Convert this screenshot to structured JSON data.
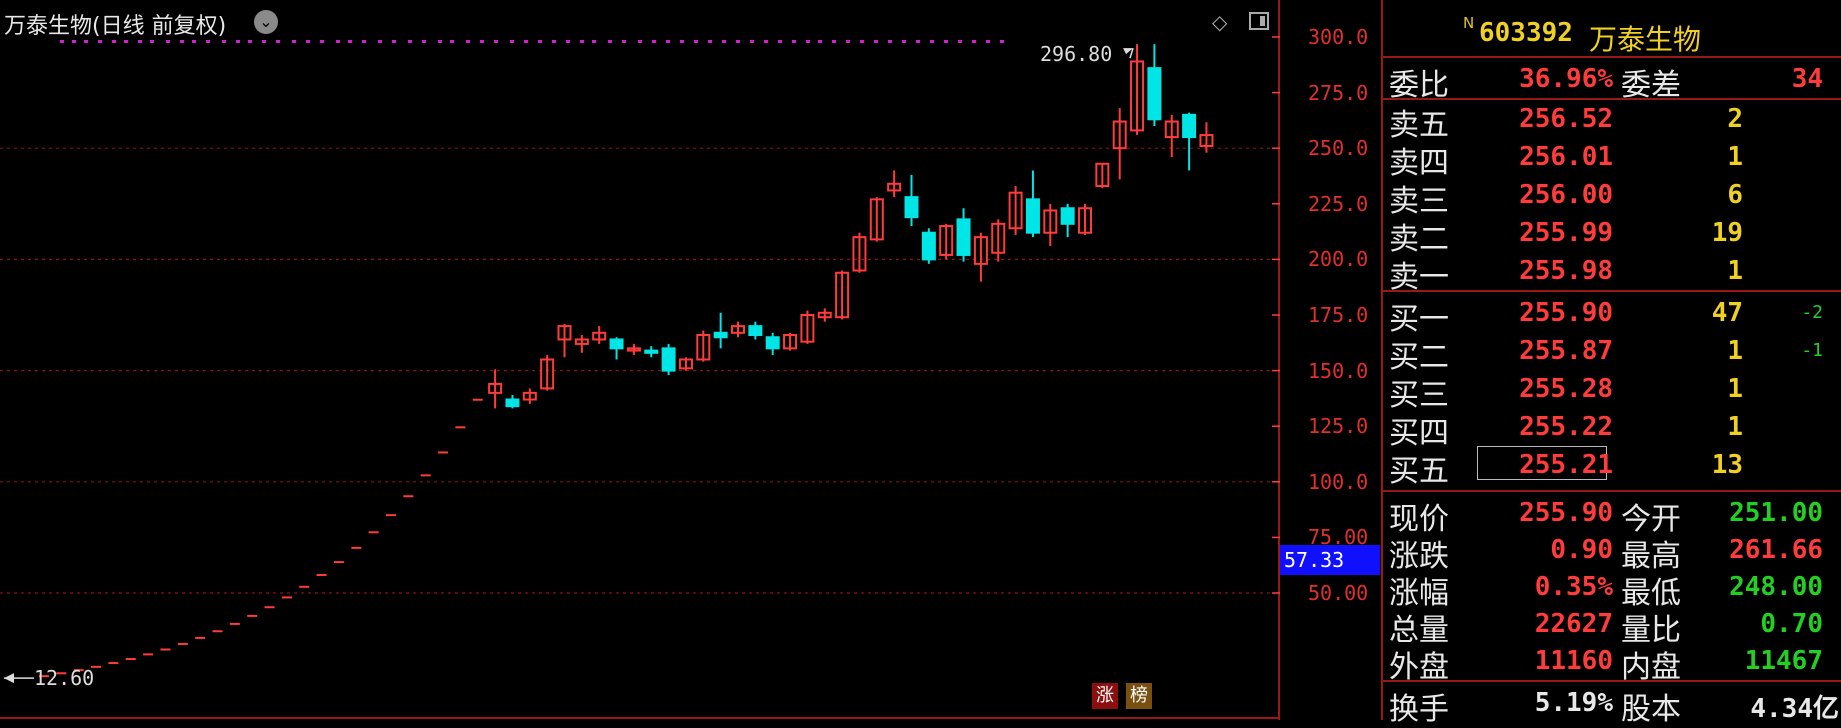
{
  "chart_title": "万泰生物(日线 前复权)",
  "title_dropdown_icon": "chevron-down-icon",
  "toolbar_icons": [
    "diamond-icon",
    "panel-toggle-icon"
  ],
  "y_ticks": [
    "300.0",
    "275.0",
    "250.0",
    "225.0",
    "200.0",
    "175.0",
    "150.0",
    "125.0",
    "100.0",
    "75.00",
    "50.00"
  ],
  "current_price_tag": "57.33",
  "high_annotation": "296.80",
  "low_annotation": "12.60",
  "badges": {
    "zhang": "涨",
    "bang": "榜"
  },
  "colors": {
    "up": "#ff3b3b",
    "down": "#00e5e5",
    "grid": "#8b1010",
    "marker": "#d020d0",
    "panel_border": "#9a1818"
  },
  "chart_data": {
    "type": "candlestick",
    "y_unit": "CNY",
    "ylim": [
      12.6,
      296.8
    ],
    "y_tick_values": [
      300,
      275,
      250,
      225,
      200,
      175,
      150,
      125,
      100,
      75,
      50
    ],
    "grid_levels": [
      250,
      200,
      150,
      100,
      50
    ],
    "high_marker": 296.8,
    "low_marker": 12.6,
    "limit_up_closes": [
      12.6,
      13.9,
      15.3,
      16.8,
      18.5,
      20.3,
      22.4,
      24.6,
      27.1,
      29.8,
      32.8,
      36.1,
      39.7,
      43.6,
      48.0,
      52.8,
      58.1,
      63.9,
      70.3,
      77.3,
      85.0,
      93.5,
      102.9,
      113.2,
      124.5,
      136.9
    ],
    "candles": [
      {
        "o": 140.0,
        "h": 150.6,
        "l": 133.0,
        "c": 144.0
      },
      {
        "o": 137.0,
        "h": 139.0,
        "l": 133.0,
        "c": 134.0
      },
      {
        "o": 137.0,
        "h": 142.0,
        "l": 135.0,
        "c": 140.0
      },
      {
        "o": 142.0,
        "h": 157.0,
        "l": 141.0,
        "c": 155.0
      },
      {
        "o": 164.0,
        "h": 171.0,
        "l": 156.0,
        "c": 170.0
      },
      {
        "o": 162.0,
        "h": 166.0,
        "l": 158.0,
        "c": 164.0
      },
      {
        "o": 164.0,
        "h": 170.0,
        "l": 162.0,
        "c": 167.0
      },
      {
        "o": 164.0,
        "h": 165.0,
        "l": 155.0,
        "c": 160.0
      },
      {
        "o": 159.0,
        "h": 162.0,
        "l": 157.0,
        "c": 160.0
      },
      {
        "o": 159.0,
        "h": 161.0,
        "l": 156.0,
        "c": 158.0
      },
      {
        "o": 160.0,
        "h": 162.0,
        "l": 148.0,
        "c": 150.0
      },
      {
        "o": 151.0,
        "h": 156.0,
        "l": 150.0,
        "c": 155.0
      },
      {
        "o": 155.0,
        "h": 168.0,
        "l": 154.0,
        "c": 166.0
      },
      {
        "o": 167.0,
        "h": 176.0,
        "l": 160.0,
        "c": 165.0
      },
      {
        "o": 167.0,
        "h": 172.0,
        "l": 165.0,
        "c": 170.0
      },
      {
        "o": 170.0,
        "h": 172.0,
        "l": 164.0,
        "c": 166.0
      },
      {
        "o": 165.0,
        "h": 167.0,
        "l": 157.0,
        "c": 160.0
      },
      {
        "o": 160.0,
        "h": 167.0,
        "l": 159.0,
        "c": 166.0
      },
      {
        "o": 163.0,
        "h": 177.0,
        "l": 162.0,
        "c": 175.0
      },
      {
        "o": 174.0,
        "h": 178.0,
        "l": 172.0,
        "c": 176.0
      },
      {
        "o": 174.0,
        "h": 195.0,
        "l": 173.0,
        "c": 194.0
      },
      {
        "o": 195.0,
        "h": 212.0,
        "l": 194.0,
        "c": 210.0
      },
      {
        "o": 209.0,
        "h": 228.0,
        "l": 208.0,
        "c": 227.0
      },
      {
        "o": 231.0,
        "h": 240.0,
        "l": 228.0,
        "c": 234.0
      },
      {
        "o": 228.0,
        "h": 238.0,
        "l": 215.0,
        "c": 219.0
      },
      {
        "o": 212.0,
        "h": 214.0,
        "l": 198.0,
        "c": 200.0
      },
      {
        "o": 202.0,
        "h": 216.0,
        "l": 200.0,
        "c": 215.0
      },
      {
        "o": 218.0,
        "h": 223.0,
        "l": 199.0,
        "c": 202.0
      },
      {
        "o": 198.0,
        "h": 212.0,
        "l": 190.0,
        "c": 210.0
      },
      {
        "o": 203.0,
        "h": 218.0,
        "l": 199.0,
        "c": 216.0
      },
      {
        "o": 214.0,
        "h": 233.0,
        "l": 211.0,
        "c": 230.0
      },
      {
        "o": 227.0,
        "h": 240.0,
        "l": 210.0,
        "c": 212.0
      },
      {
        "o": 212.0,
        "h": 225.0,
        "l": 206.0,
        "c": 222.0
      },
      {
        "o": 223.0,
        "h": 225.0,
        "l": 210.0,
        "c": 216.0
      },
      {
        "o": 212.0,
        "h": 225.0,
        "l": 211.0,
        "c": 223.0
      },
      {
        "o": 233.0,
        "h": 243.0,
        "l": 232.0,
        "c": 243.0
      },
      {
        "o": 250.0,
        "h": 268.0,
        "l": 236.0,
        "c": 262.0
      },
      {
        "o": 258.0,
        "h": 296.8,
        "l": 256.0,
        "c": 289.0
      },
      {
        "o": 286.0,
        "h": 296.8,
        "l": 260.0,
        "c": 263.0
      },
      {
        "o": 255.0,
        "h": 265.0,
        "l": 246.0,
        "c": 262.0
      },
      {
        "o": 265.0,
        "h": 266.0,
        "l": 240.0,
        "c": 255.0
      },
      {
        "o": 251.0,
        "h": 261.66,
        "l": 248.0,
        "c": 255.9
      }
    ],
    "x_count": 69,
    "candle_start_index": 26
  },
  "panel": {
    "new_badge": "N",
    "code": "603392",
    "name": "万泰生物",
    "weibi": {
      "label": "委比",
      "value": "36.96%",
      "diff_label": "委差",
      "diff_value": "34"
    },
    "asks": [
      {
        "label": "卖五",
        "price": "256.52",
        "vol": "2"
      },
      {
        "label": "卖四",
        "price": "256.01",
        "vol": "1"
      },
      {
        "label": "卖三",
        "price": "256.00",
        "vol": "6"
      },
      {
        "label": "卖二",
        "price": "255.99",
        "vol": "19"
      },
      {
        "label": "卖一",
        "price": "255.98",
        "vol": "1"
      }
    ],
    "bids": [
      {
        "label": "买一",
        "price": "255.90",
        "vol": "47",
        "chg": "-2"
      },
      {
        "label": "买二",
        "price": "255.87",
        "vol": "1",
        "chg": "-1"
      },
      {
        "label": "买三",
        "price": "255.28",
        "vol": "1",
        "chg": ""
      },
      {
        "label": "买四",
        "price": "255.22",
        "vol": "1",
        "chg": ""
      },
      {
        "label": "买五",
        "price": "255.21",
        "vol": "13",
        "chg": ""
      }
    ],
    "stats": [
      {
        "l1": "现价",
        "v1": "255.90",
        "c1": "red",
        "l2": "今开",
        "v2": "251.00",
        "c2": "green"
      },
      {
        "l1": "涨跌",
        "v1": "0.90",
        "c1": "red",
        "l2": "最高",
        "v2": "261.66",
        "c2": "red"
      },
      {
        "l1": "涨幅",
        "v1": "0.35%",
        "c1": "red",
        "l2": "最低",
        "v2": "248.00",
        "c2": "green"
      },
      {
        "l1": "总量",
        "v1": "22627",
        "c1": "red",
        "l2": "量比",
        "v2": "0.70",
        "c2": "green"
      },
      {
        "l1": "外盘",
        "v1": "11160",
        "c1": "red",
        "l2": "内盘",
        "v2": "11467",
        "c2": "green"
      }
    ],
    "turnover": {
      "l1": "换手",
      "v1": "5.19%",
      "l2": "股本",
      "v2": "4.34亿"
    }
  }
}
